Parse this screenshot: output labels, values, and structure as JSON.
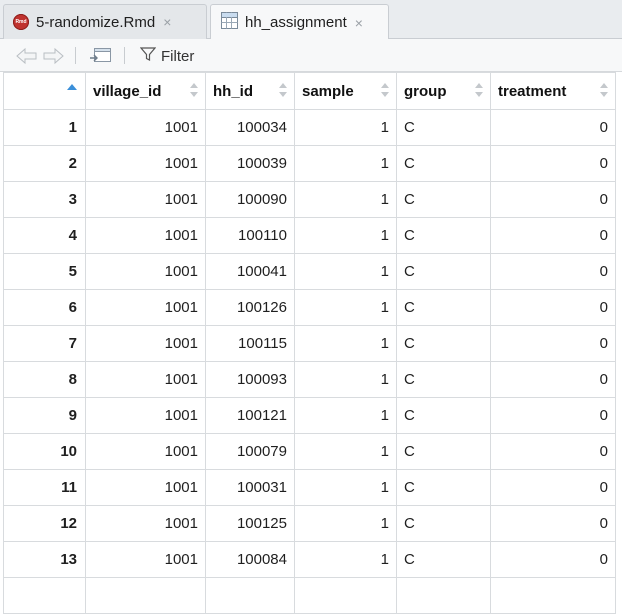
{
  "tabs": [
    {
      "label": "5-randomize.Rmd",
      "icon": "rmd-file-icon",
      "active": false
    },
    {
      "label": "hh_assignment",
      "icon": "data-grid-icon",
      "active": true
    }
  ],
  "rmd_icon_text": "Rmd",
  "close_glyph": "×",
  "toolbar": {
    "filter_label": "Filter",
    "icons": [
      "back-arrow-icon",
      "forward-arrow-icon",
      "popout-window-icon",
      "filter-icon"
    ]
  },
  "table": {
    "columns": [
      "",
      "village_id",
      "hh_id",
      "sample",
      "group",
      "treatment"
    ],
    "rows": [
      [
        "1",
        "1001",
        "100034",
        "1",
        "C",
        "0"
      ],
      [
        "2",
        "1001",
        "100039",
        "1",
        "C",
        "0"
      ],
      [
        "3",
        "1001",
        "100090",
        "1",
        "C",
        "0"
      ],
      [
        "4",
        "1001",
        "100110",
        "1",
        "C",
        "0"
      ],
      [
        "5",
        "1001",
        "100041",
        "1",
        "C",
        "0"
      ],
      [
        "6",
        "1001",
        "100126",
        "1",
        "C",
        "0"
      ],
      [
        "7",
        "1001",
        "100115",
        "1",
        "C",
        "0"
      ],
      [
        "8",
        "1001",
        "100093",
        "1",
        "C",
        "0"
      ],
      [
        "9",
        "1001",
        "100121",
        "1",
        "C",
        "0"
      ],
      [
        "10",
        "1001",
        "100079",
        "1",
        "C",
        "0"
      ],
      [
        "11",
        "1001",
        "100031",
        "1",
        "C",
        "0"
      ],
      [
        "12",
        "1001",
        "100125",
        "1",
        "C",
        "0"
      ],
      [
        "13",
        "1001",
        "100084",
        "1",
        "C",
        "0"
      ],
      [
        "",
        "",
        "",
        "",
        "",
        ""
      ]
    ]
  },
  "colors": {
    "sort_active": "#3b8fd9",
    "rmd_icon": "#c0332f"
  }
}
